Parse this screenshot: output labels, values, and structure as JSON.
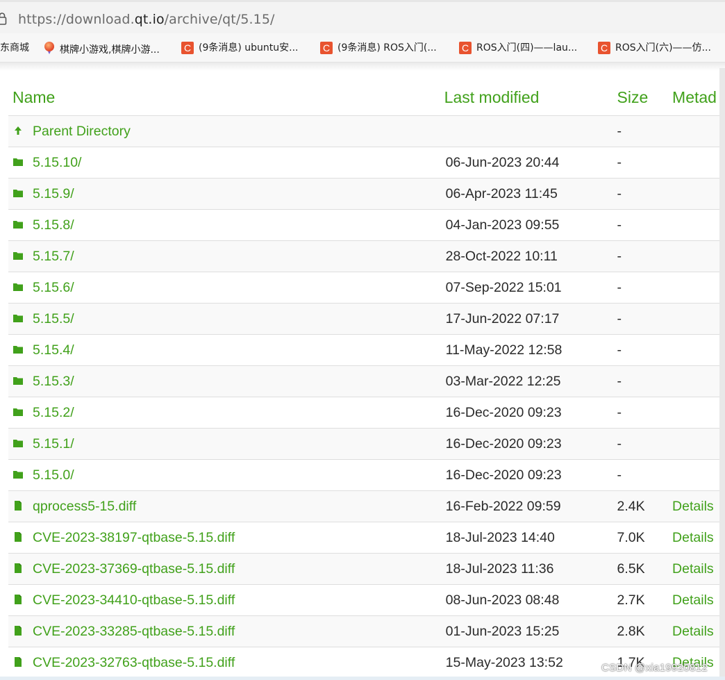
{
  "browser": {
    "url_prefix": "https://download.",
    "url_host": "qt.io",
    "url_path": "/archive/qt/5.15/",
    "bookmarks": [
      {
        "label": "东商城",
        "icon": "none"
      },
      {
        "label": "棋牌小游戏,棋牌小游...",
        "icon": "balloon-icon"
      },
      {
        "label": "(9条消息) ubuntu安...",
        "icon": "csdn-icon"
      },
      {
        "label": "(9条消息) ROS入门(...",
        "icon": "csdn-icon"
      },
      {
        "label": "ROS入门(四)——lau...",
        "icon": "csdn-icon"
      },
      {
        "label": "ROS入门(六)——仿...",
        "icon": "csdn-icon"
      }
    ]
  },
  "table": {
    "headers": {
      "name": "Name",
      "modified": "Last modified",
      "size": "Size",
      "metadata": "Metad"
    },
    "rows": [
      {
        "type": "parent",
        "name": "Parent Directory",
        "modified": "",
        "size": "-",
        "meta": ""
      },
      {
        "type": "folder",
        "name": "5.15.10/",
        "modified": "06-Jun-2023 20:44",
        "size": "-",
        "meta": ""
      },
      {
        "type": "folder",
        "name": "5.15.9/",
        "modified": "06-Apr-2023 11:45",
        "size": "-",
        "meta": ""
      },
      {
        "type": "folder",
        "name": "5.15.8/",
        "modified": "04-Jan-2023 09:55",
        "size": "-",
        "meta": ""
      },
      {
        "type": "folder",
        "name": "5.15.7/",
        "modified": "28-Oct-2022 10:11",
        "size": "-",
        "meta": ""
      },
      {
        "type": "folder",
        "name": "5.15.6/",
        "modified": "07-Sep-2022 15:01",
        "size": "-",
        "meta": ""
      },
      {
        "type": "folder",
        "name": "5.15.5/",
        "modified": "17-Jun-2022 07:17",
        "size": "-",
        "meta": ""
      },
      {
        "type": "folder",
        "name": "5.15.4/",
        "modified": "11-May-2022 12:58",
        "size": "-",
        "meta": ""
      },
      {
        "type": "folder",
        "name": "5.15.3/",
        "modified": "03-Mar-2022 12:25",
        "size": "-",
        "meta": ""
      },
      {
        "type": "folder",
        "name": "5.15.2/",
        "modified": "16-Dec-2020 09:23",
        "size": "-",
        "meta": ""
      },
      {
        "type": "folder",
        "name": "5.15.1/",
        "modified": "16-Dec-2020 09:23",
        "size": "-",
        "meta": ""
      },
      {
        "type": "folder",
        "name": "5.15.0/",
        "modified": "16-Dec-2020 09:23",
        "size": "-",
        "meta": ""
      },
      {
        "type": "file",
        "name": "qprocess5-15.diff",
        "modified": "16-Feb-2022 09:59",
        "size": "2.4K",
        "meta": "Details"
      },
      {
        "type": "file",
        "name": "CVE-2023-38197-qtbase-5.15.diff",
        "modified": "18-Jul-2023 14:40",
        "size": "7.0K",
        "meta": "Details"
      },
      {
        "type": "file",
        "name": "CVE-2023-37369-qtbase-5.15.diff",
        "modified": "18-Jul-2023 11:36",
        "size": "6.5K",
        "meta": "Details"
      },
      {
        "type": "file",
        "name": "CVE-2023-34410-qtbase-5.15.diff",
        "modified": "08-Jun-2023 08:48",
        "size": "2.7K",
        "meta": "Details"
      },
      {
        "type": "file",
        "name": "CVE-2023-33285-qtbase-5.15.diff",
        "modified": "01-Jun-2023 15:25",
        "size": "2.8K",
        "meta": "Details"
      },
      {
        "type": "file",
        "name": "CVE-2023-32763-qtbase-5.15.diff",
        "modified": "15-May-2023 13:52",
        "size": "1.7K",
        "meta": "Details"
      }
    ]
  },
  "watermark": "CSDN @xia19920812",
  "colors": {
    "link_green": "#41a11b",
    "csdn_red": "#e8532f"
  }
}
